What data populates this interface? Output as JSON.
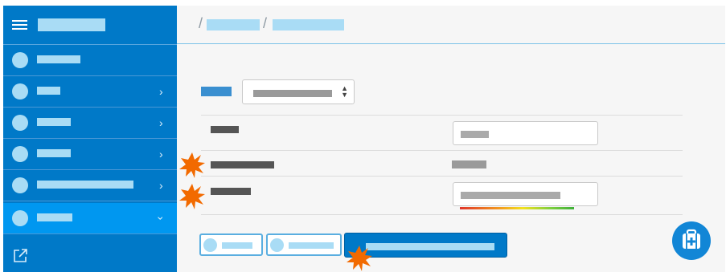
{
  "app": {
    "title": ""
  },
  "sidebar": {
    "items": [
      {
        "label": "",
        "has_chevron": false
      },
      {
        "label": "",
        "has_chevron": true
      },
      {
        "label": "",
        "has_chevron": true
      },
      {
        "label": "",
        "has_chevron": true
      },
      {
        "label": "",
        "has_chevron": true
      },
      {
        "label": "",
        "has_chevron": true,
        "active": true
      }
    ],
    "external_link_icon": "external-link-icon",
    "menu_icon": "hamburger-icon"
  },
  "breadcrumb": {
    "separator": "/",
    "items": [
      "",
      ""
    ]
  },
  "form": {
    "select_label": "",
    "select_value": "",
    "rows": [
      {
        "label": "",
        "type": "input",
        "value": ""
      },
      {
        "label": "",
        "type": "text",
        "value": "",
        "marked": true
      },
      {
        "label": "",
        "type": "password",
        "value": "",
        "marked": true,
        "strength_meter": true
      }
    ]
  },
  "buttons": [
    {
      "label": "",
      "style": "outline",
      "icon": "circle-icon"
    },
    {
      "label": "",
      "style": "outline",
      "icon": "circle-icon"
    },
    {
      "label": "",
      "style": "primary",
      "marked": true
    }
  ],
  "fab": {
    "icon": "first-aid-kit-icon"
  },
  "colors": {
    "sidebar": "#0079c8",
    "active_item": "#0097f0",
    "accent": "#1286d6",
    "marker": "#f26a00"
  }
}
